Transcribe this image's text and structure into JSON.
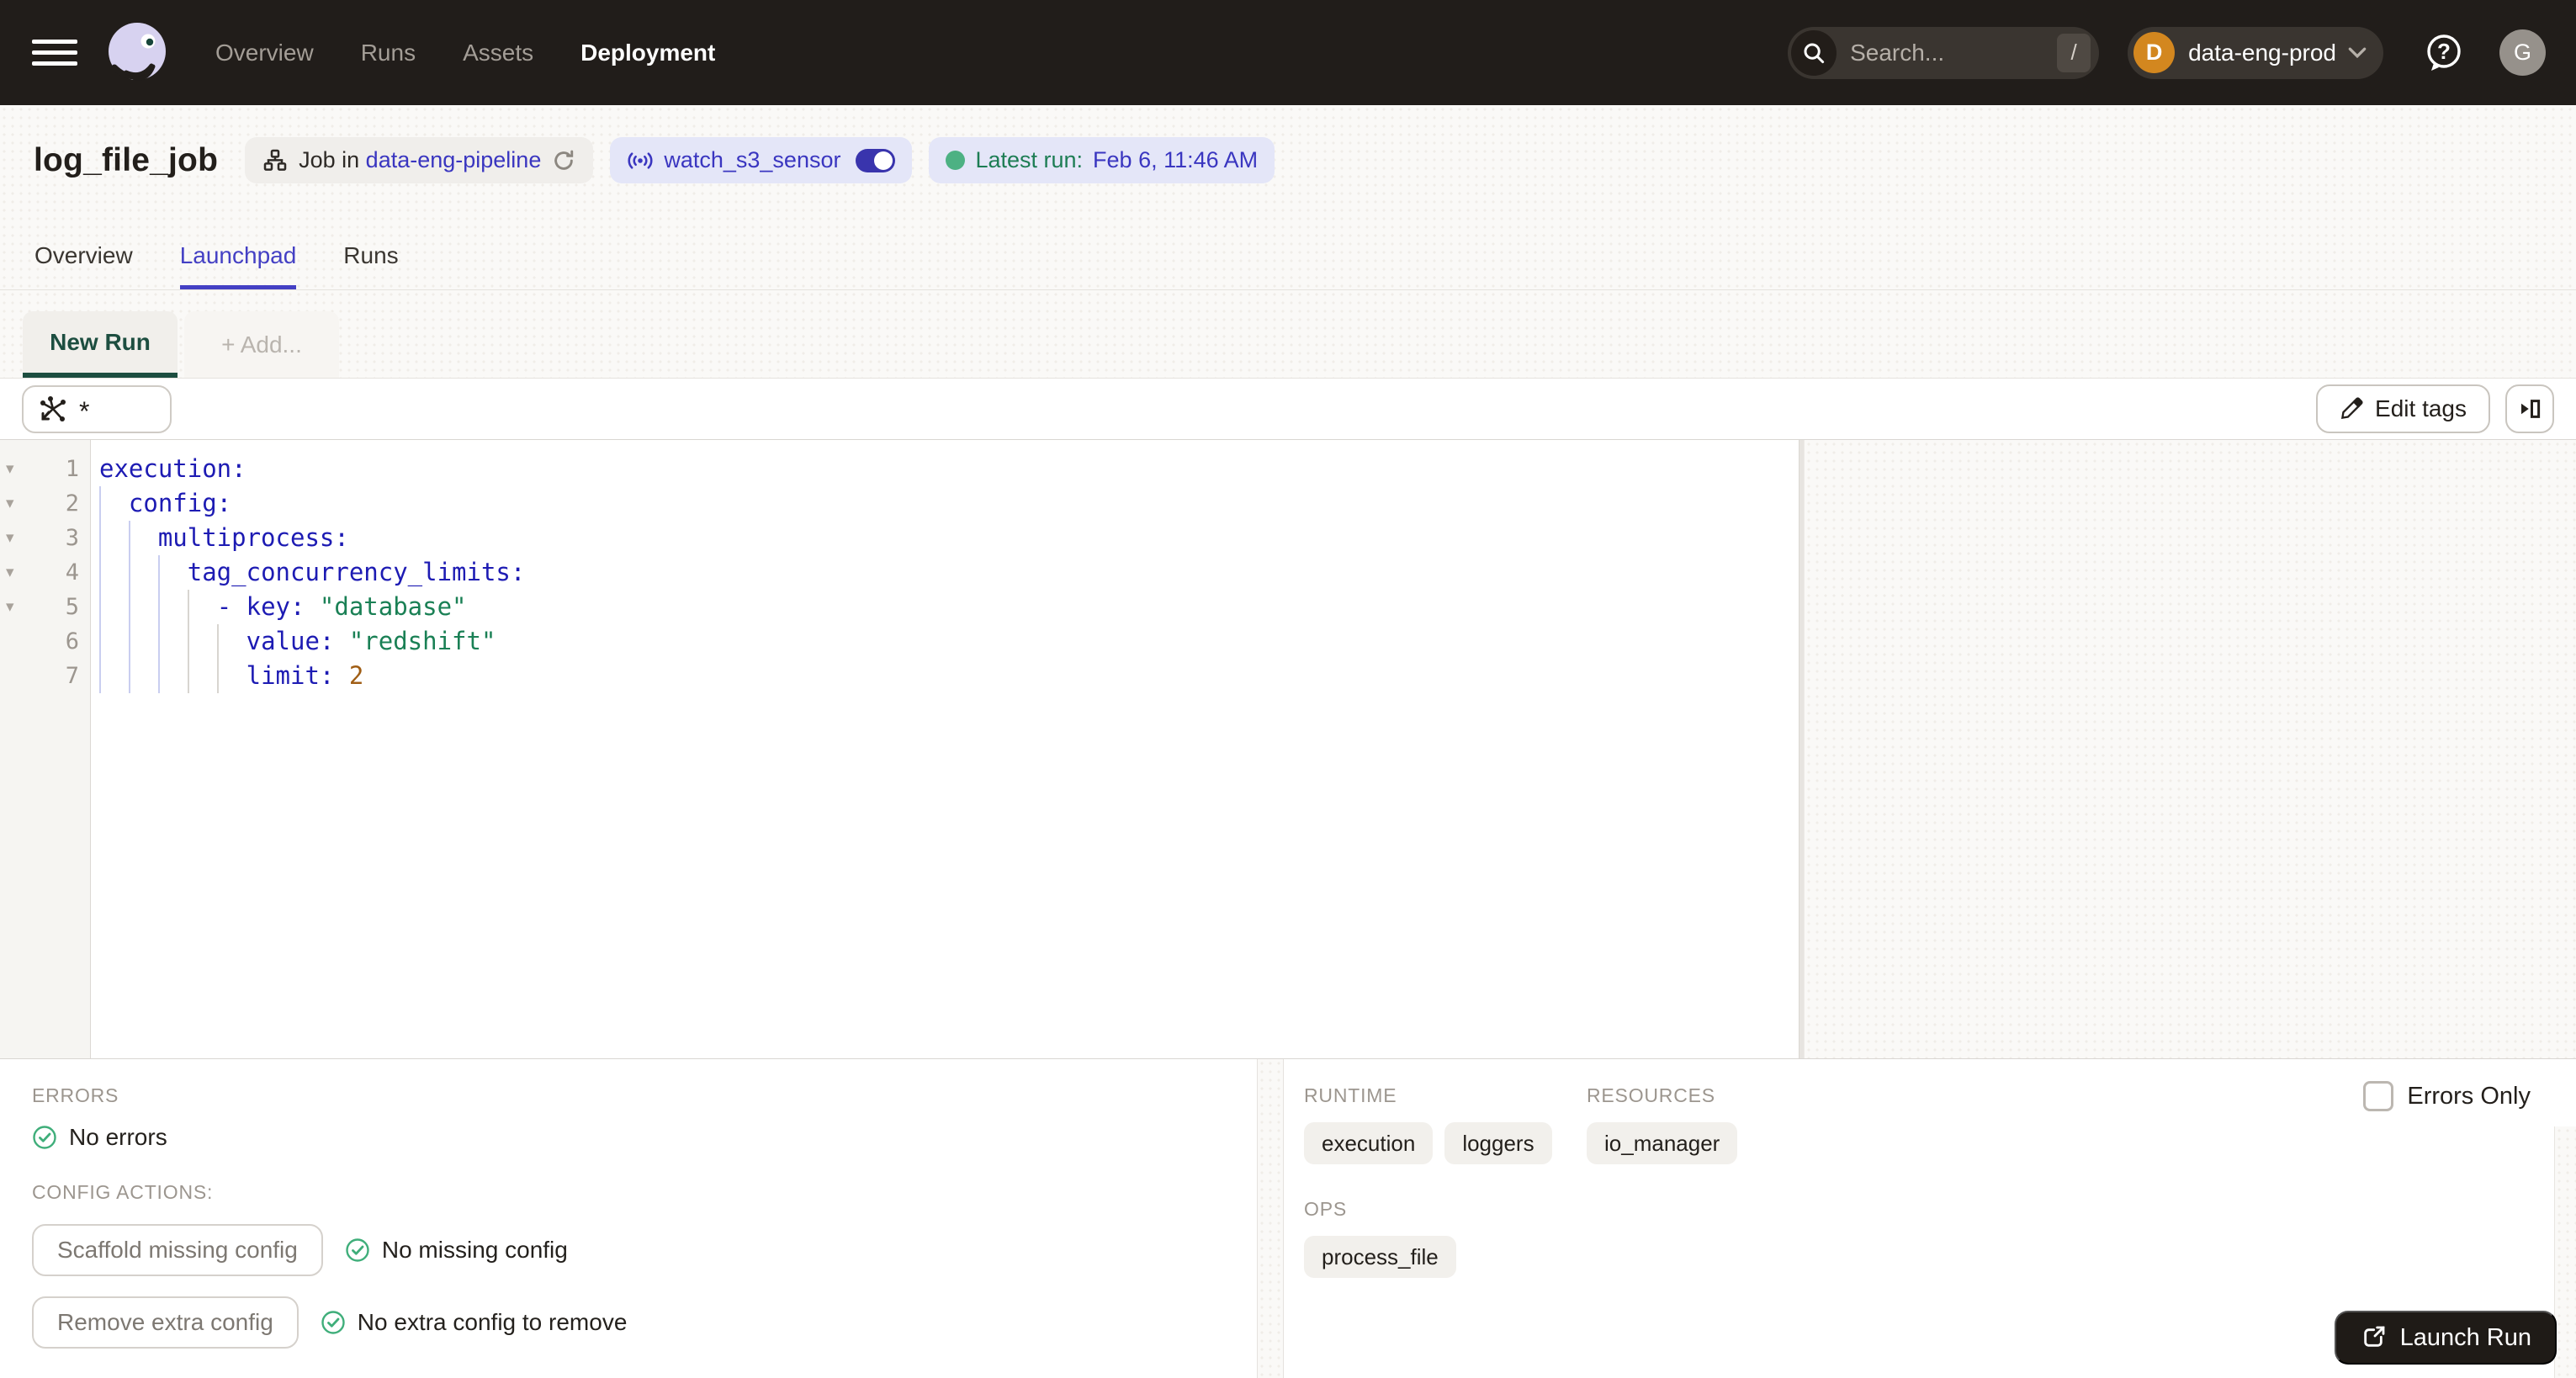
{
  "topbar": {
    "nav": [
      "Overview",
      "Runs",
      "Assets",
      "Deployment"
    ],
    "search": {
      "placeholder": "Search...",
      "shortcut": "/"
    },
    "workspace": {
      "label": "data-eng-prod",
      "initial": "D"
    },
    "user": {
      "initial": "G"
    }
  },
  "header": {
    "title": "log_file_job",
    "job_chip": {
      "prefix": "Job in",
      "link": "data-eng-pipeline"
    },
    "sensor_chip": {
      "label": "watch_s3_sensor"
    },
    "latest_chip": {
      "prefix": "Latest run:",
      "value": "Feb 6, 11:46 AM"
    },
    "tabs": [
      "Overview",
      "Launchpad",
      "Runs"
    ]
  },
  "run_tabs": {
    "new_run": "New Run",
    "add": "+ Add..."
  },
  "toolbar": {
    "op_selector": "*",
    "edit_tags": "Edit tags"
  },
  "editor": {
    "language": "yaml",
    "lines": [
      {
        "n": 1,
        "fold": true,
        "t": [
          [
            "k",
            "execution:"
          ]
        ]
      },
      {
        "n": 2,
        "fold": true,
        "t": [
          [
            "p",
            "  "
          ],
          [
            "k",
            "config:"
          ]
        ]
      },
      {
        "n": 3,
        "fold": true,
        "t": [
          [
            "p",
            "    "
          ],
          [
            "k",
            "multiprocess:"
          ]
        ]
      },
      {
        "n": 4,
        "fold": true,
        "t": [
          [
            "p",
            "      "
          ],
          [
            "k",
            "tag_concurrency_limits:"
          ]
        ]
      },
      {
        "n": 5,
        "fold": true,
        "t": [
          [
            "p",
            "        "
          ],
          [
            "k",
            "- key:"
          ],
          [
            "p",
            " "
          ],
          [
            "s",
            "\"database\""
          ]
        ]
      },
      {
        "n": 6,
        "fold": false,
        "t": [
          [
            "p",
            "          "
          ],
          [
            "k",
            "value:"
          ],
          [
            "p",
            " "
          ],
          [
            "s",
            "\"redshift\""
          ]
        ]
      },
      {
        "n": 7,
        "fold": false,
        "t": [
          [
            "p",
            "          "
          ],
          [
            "k",
            "limit:"
          ],
          [
            "p",
            " "
          ],
          [
            "n",
            "2"
          ]
        ]
      }
    ]
  },
  "bottom": {
    "errors": {
      "heading": "ERRORS",
      "status": "No errors"
    },
    "config_actions": {
      "heading": "CONFIG ACTIONS:",
      "actions": [
        {
          "button": "Scaffold missing config",
          "status": "No missing config"
        },
        {
          "button": "Remove extra config",
          "status": "No extra config to remove"
        }
      ]
    },
    "preview": {
      "runtime": {
        "heading": "RUNTIME",
        "chips": [
          "execution",
          "loggers"
        ]
      },
      "resources": {
        "heading": "RESOURCES",
        "chips": [
          "io_manager"
        ]
      },
      "ops": {
        "heading": "OPS",
        "chips": [
          "process_file"
        ]
      },
      "errors_only": "Errors Only"
    },
    "launch": {
      "label": "Launch Run"
    }
  },
  "colors": {
    "topbar_bg": "#211d1a",
    "accent_indigo": "#4440c4",
    "link_indigo": "#3a36c0",
    "active_tab_green": "#1d4e40",
    "status_green": "#3fae7a",
    "latest_green": "#1d7d54",
    "workspace_avatar_orange": "#d3871f",
    "code_key": "#1d1bb3",
    "code_string": "#1a8055",
    "code_number": "#a05e15",
    "chip_lavender": "#e4e6f8",
    "chip_gray": "#f0eeeb"
  }
}
